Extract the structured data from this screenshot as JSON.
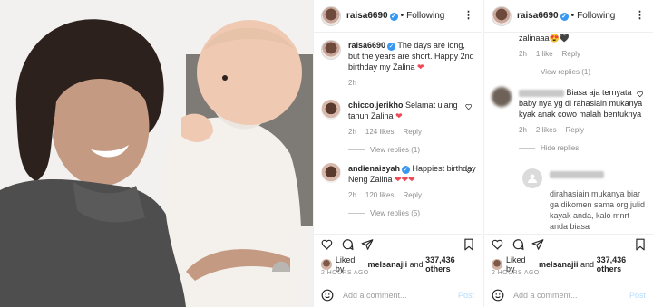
{
  "post": {
    "username": "raisa6690",
    "follow_status": "Following",
    "more_icon": "more-dots-icon",
    "caption": "The days are long, but the years are short. Happy 2nd birthday my Zalina",
    "caption_time": "2h"
  },
  "comments_left": [
    {
      "username": "chicco.jerikho",
      "text": "Selamat ulang tahun Zalina",
      "time": "2h",
      "likes": "124 likes",
      "reply": "Reply",
      "view_replies": "View replies (1)"
    },
    {
      "username": "andienaisyah",
      "text": "Happiest birthday Neng Zalina",
      "time": "2h",
      "likes": "120 likes",
      "reply": "Reply",
      "view_replies": "View replies (5)"
    }
  ],
  "comments_right": {
    "top_partial_text": "zalinaaa",
    "top_time": "2h",
    "top_likes": "1 like",
    "top_reply": "Reply",
    "top_view_replies": "View replies (1)",
    "c2_text": "Biasa aja ternyata baby nya yg di rahasiain mukanya kyak anak cowo malah bentuknya",
    "c2_time": "2h",
    "c2_likes": "2 likes",
    "c2_reply": "Reply",
    "c2_hide": "Hide replies",
    "c3_text": "dirahasiain mukanya biar ga dikomen sama org julid kayak anda, kalo mnrt anda biasa"
  },
  "footer": {
    "liked_prefix": "Liked by",
    "liked_user": "melsanajii",
    "liked_and": "and",
    "liked_others": "337,436 others",
    "ago": "2 HOURS AGO",
    "add_placeholder": "Add a comment...",
    "post_label": "Post"
  },
  "icons": [
    "heart-icon",
    "comment-icon",
    "share-icon",
    "bookmark-icon",
    "smiley-icon"
  ],
  "colors": {
    "verified": "#3897f0",
    "like_red": "#ed4956",
    "muted": "#8e8e8e",
    "post_disabled": "#b3dbff"
  }
}
